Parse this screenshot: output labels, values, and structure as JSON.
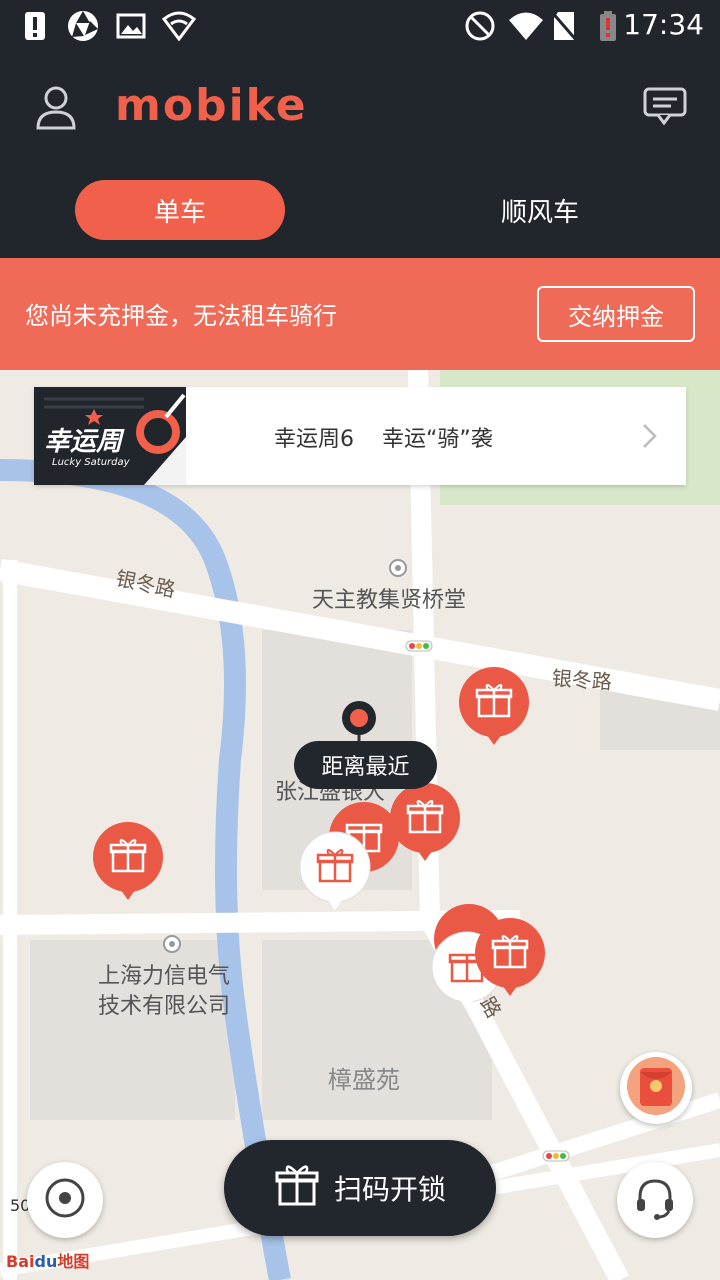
{
  "status_bar": {
    "time": "17:34",
    "left_icons": [
      "alert-icon",
      "aperture-icon",
      "image-icon",
      "wifi-shield-icon"
    ],
    "right_icons": [
      "block-icon",
      "wifi-icon",
      "no-sim-icon",
      "battery-low-icon"
    ]
  },
  "header": {
    "logo": "mobike",
    "tabs": [
      {
        "label": "单车",
        "active": true
      },
      {
        "label": "顺风车",
        "active": false
      }
    ]
  },
  "deposit_banner": {
    "message": "您尚未充押金，无法租车骑行",
    "button_label": "交纳押金"
  },
  "promo_banner": {
    "image_title": "幸运周",
    "image_subtitle": "Lucky Saturday",
    "text": "幸运周6    幸运“骑”袭"
  },
  "map": {
    "labels": {
      "church": "天主教集贤桥堂",
      "road_1": "银冬路",
      "road_2": "银冬路",
      "building": "张江盛银大",
      "company_line1": "上海力信电气",
      "company_line2": "技术有限公司",
      "estate": "樟盛苑",
      "road_3": "路"
    },
    "nearest_tooltip": "距离最近",
    "scale": "50",
    "provider_bai": "Bai",
    "provider_du": "du",
    "provider_map": "地图"
  },
  "bottom": {
    "scan_label": "扫码开锁"
  },
  "colors": {
    "accent": "#f0604b",
    "dark": "#21252c",
    "white": "#ffffff"
  }
}
